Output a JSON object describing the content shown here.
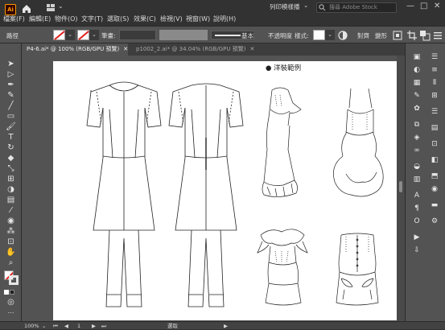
{
  "app": {
    "logo_text": "Ai"
  },
  "menu": {
    "items": [
      "檔案(F)",
      "編輯(E)",
      "物件(O)",
      "文字(T)",
      "選取(S)",
      "效果(C)",
      "檢視(V)",
      "視窗(W)",
      "說明(H)"
    ]
  },
  "titlebar": {
    "print_mode": "列印模樣播",
    "search_placeholder": "搜尋 Adobe Stock",
    "window_buttons": [
      "—",
      "□",
      "✕"
    ]
  },
  "control": {
    "label_path": "路徑",
    "opacity_label": "筆畫:",
    "stroke_style": "基本",
    "opacity_text": "不透明度",
    "style_label": "樣式:",
    "btn_recolor": "對齊",
    "btn_transform": "變形",
    "stroke_color": "#e0201c"
  },
  "tabs": [
    {
      "label": "P4-6.ai* @ 100% (RGB/GPU 預覽)",
      "active": true
    },
    {
      "label": "p1002_2.ai* @ 34.04% (RGB/GPU 預覽)",
      "active": false
    }
  ],
  "artboard": {
    "heading": "● 洋裝範例"
  },
  "status": {
    "zoom": "100%",
    "page": "1",
    "tool_name": "選取"
  },
  "icons": {
    "home": "home-icon",
    "workspace": "workspace-icon",
    "search": "search-icon"
  }
}
